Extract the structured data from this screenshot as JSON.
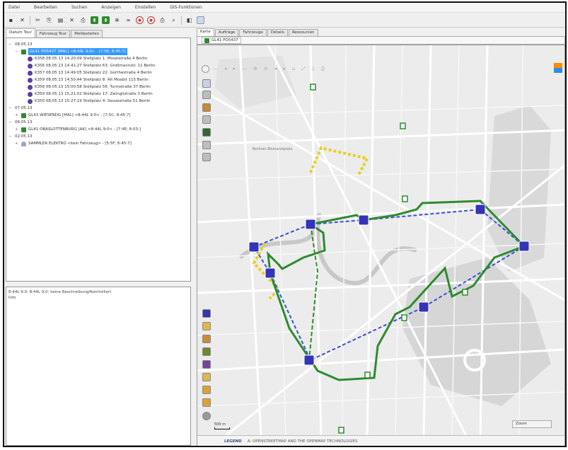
{
  "menu": [
    "Datei",
    "Bearbeiten",
    "Suchen",
    "Anzeigen",
    "Einstellen",
    "GIS-Funktionen"
  ],
  "left_tabs": [
    "Datum Tour",
    "Fahrzeug Tour",
    "Meldestellen"
  ],
  "tree": [
    {
      "indent": 0,
      "icon": "",
      "text": "08.05.13",
      "toggle": "−"
    },
    {
      "indent": 1,
      "icon": "green",
      "text": "GL41 PO5437 [MAL] <8:44L 9:0> - [7:5E; 8:45:7]",
      "toggle": "−",
      "selected": true
    },
    {
      "indent": 2,
      "icon": "stop",
      "text": "K358 08.05.13 14:20:09 Stellplatz 1: Moselstraße 4 Berlin"
    },
    {
      "indent": 2,
      "icon": "stop",
      "text": "K356 08.05.13 14:41:27 Stellplatz 63: Großmannstr. 11 Berlin"
    },
    {
      "indent": 2,
      "icon": "stop",
      "text": "K357 08.05.13 14:49:05 Stellplatz 22: Gorthestraße 4 Berlin"
    },
    {
      "indent": 2,
      "icon": "stop",
      "text": "K359 08.05.13 14:50:44 Stellplatz 8: Alt Moabit 115 Berlin"
    },
    {
      "indent": 2,
      "icon": "stop",
      "text": "K358 08.05.13 15:00:58 Stellplatz 56: Turmstraße 37 Berlin"
    },
    {
      "indent": 2,
      "icon": "stop",
      "text": "K359 08.05.13 15:21:02 Stellplatz 17: Zwinglistraße 3 Berlin"
    },
    {
      "indent": 2,
      "icon": "stop",
      "text": "K350 08.05.13 15:27:19 Stellplatz 4: Seusestraße 51 Berlin"
    },
    {
      "indent": 0,
      "icon": "",
      "text": "07.05.13",
      "toggle": "−"
    },
    {
      "indent": 1,
      "icon": "green",
      "text": "GL43 WIESENDG [MAL] <8:44L 9:0> - [7:5C; 8:45:7]",
      "toggle": "+"
    },
    {
      "indent": 0,
      "icon": "",
      "text": "06.05.13",
      "toggle": "−"
    },
    {
      "indent": 1,
      "icon": "green",
      "text": "GL41 OBASLOTTENBURG [AK] <8:44L 9:0> - [7:4E; 8:03:]",
      "toggle": "+"
    },
    {
      "indent": 0,
      "icon": "",
      "text": "02.05.13",
      "toggle": "−"
    },
    {
      "indent": 1,
      "icon": "person",
      "text": "SAMMLER ELEKTRO <kein Fahrzeug> - [5:5F; 6:45:7]",
      "toggle": "+"
    }
  ],
  "status_lines": [
    "8:44L 9:0:   8:44L 9:0: keine Beschreibung/Kontrolliert",
    "Info"
  ],
  "right_tabs": [
    "Karte",
    "Aufträge",
    "Fahrzeuge",
    "Details",
    "Ressourcen"
  ],
  "map_subtab": "GL41 PO5437",
  "map_labels": [
    {
      "text": "Berliner Bismarckplatz"
    }
  ],
  "scale_label": "500 m",
  "zoom_box": "Zoom",
  "footer_label": "LEGEND",
  "footer_text": "A: OPENSTREETMAP AND THE OPENMAP TECHNOLOGIES",
  "colors": {
    "route": "#2e8b2e",
    "stop": "#3434b8",
    "dashed_blue": "#3a4fd8",
    "dashed_yellow": "#e8d020",
    "selection": "#3399ff"
  }
}
